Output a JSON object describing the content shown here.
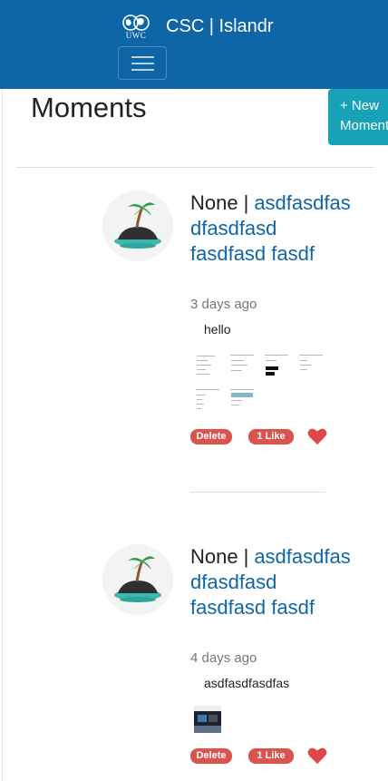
{
  "navbar": {
    "logo_text": "UWC",
    "title": "CSC | Islandr"
  },
  "page": {
    "title": "Moments",
    "new_button_line1": "+ New",
    "new_button_line2": "Moment"
  },
  "moments": [
    {
      "author_prefix": "None",
      "separator": "|",
      "author_name": "asdfasdfas dfasdfasd fasdfasd fasdf",
      "time": "3 days ago",
      "content": "hello",
      "delete_label": "Delete",
      "like_label": "1 Like"
    },
    {
      "author_prefix": "None",
      "separator": "|",
      "author_name": "asdfasdfas dfasdfasd fasdfasd fasdf",
      "time": "4 days ago",
      "content": "asdfasdfasdfas",
      "delete_label": "Delete",
      "like_label": "1 Like"
    }
  ],
  "colors": {
    "navbar": "#0f66a7",
    "accent_button": "#17a2b8",
    "danger": "#d9534f",
    "link": "#0f66a7"
  }
}
